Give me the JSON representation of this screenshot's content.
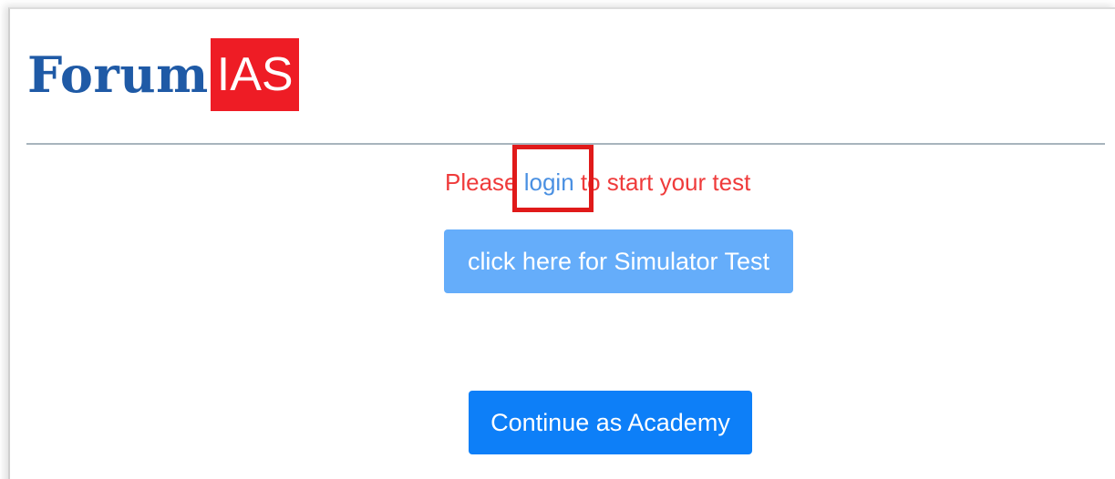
{
  "logo": {
    "part1": "Forum",
    "part2": "IAS",
    "colors": {
      "forum_text": "#1f5aa6",
      "ias_background": "#ee1c25"
    }
  },
  "notice": {
    "prefix": "Please ",
    "link": "login",
    "suffix": " to start your test",
    "text_color": "#ef3b3b",
    "link_color": "#4a90e2"
  },
  "buttons": {
    "simulator_label": "click here for Simulator Test",
    "academy_label": "Continue as Academy",
    "simulator_color": "#65adfa",
    "academy_color": "#0d7ff8"
  },
  "annotation": {
    "highlight_color": "#e01a1a"
  }
}
